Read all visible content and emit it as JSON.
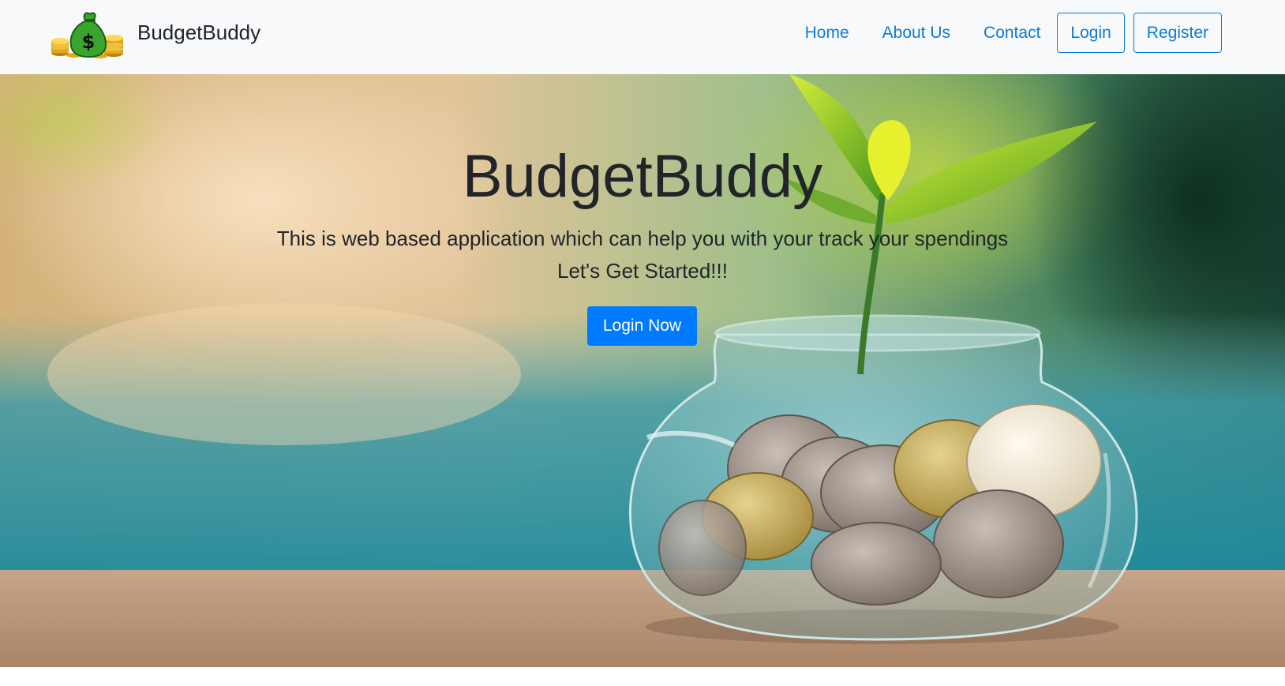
{
  "navbar": {
    "brand_name": "BudgetBuddy",
    "logo_icon": "money-bag-icon",
    "links": [
      {
        "label": "Home"
      },
      {
        "label": "About Us"
      },
      {
        "label": "Contact"
      }
    ],
    "login_label": "Login",
    "register_label": "Register",
    "link_color": "#0d7ad6"
  },
  "hero": {
    "title": "BudgetBuddy",
    "tagline": "This is web based application which can help you with your track your spendings",
    "subtitle": "Let's Get Started!!!",
    "cta_label": "Login Now",
    "cta_color": "#007bff",
    "background": "coin-jar-with-sprouting-plant-image"
  }
}
